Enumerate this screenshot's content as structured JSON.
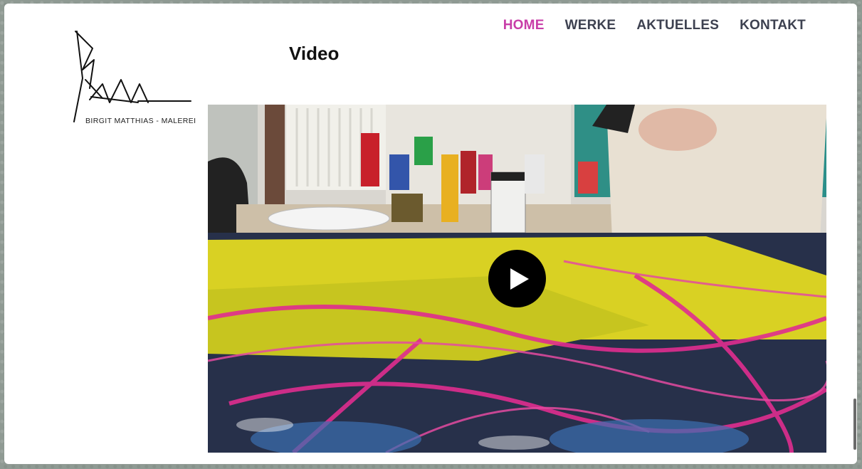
{
  "logo": {
    "monogram": "BM",
    "text": "BIRGIT MATTHIAS - MALEREI"
  },
  "nav": {
    "items": [
      {
        "label": "HOME",
        "active": true
      },
      {
        "label": "WERKE",
        "active": false
      },
      {
        "label": "AKTUELLES",
        "active": false
      },
      {
        "label": "KONTAKT",
        "active": false
      }
    ]
  },
  "section": {
    "title": "Video"
  },
  "video": {
    "play_icon": "play-icon"
  },
  "colors": {
    "nav_active": "#c83ea8",
    "nav_default": "#3d4150",
    "play_button": "#000000"
  }
}
